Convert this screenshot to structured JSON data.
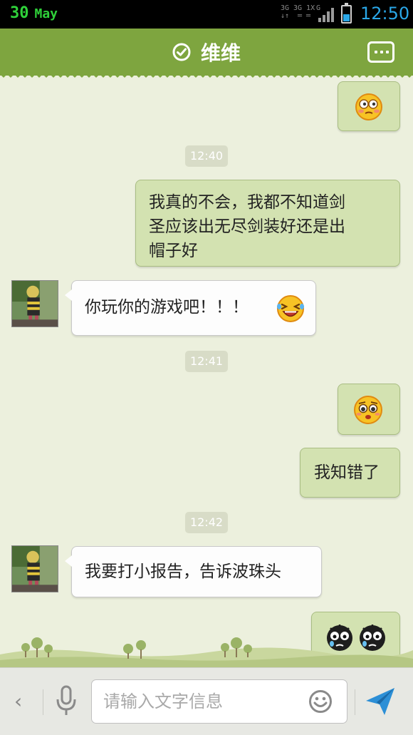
{
  "status_bar": {
    "day": "30",
    "month": "May",
    "net_top": "3G 3G 1X  G",
    "time": "12:50",
    "colors": {
      "clock": "#2aa7e8",
      "date": "#2fd13a"
    }
  },
  "header": {
    "title": "维维",
    "verified_icon": "check-circle-icon",
    "menu_icon": "more-dots-icon",
    "color": "#7ea53f"
  },
  "messages": [
    {
      "type": "emoji",
      "side": "sent",
      "emoji": "flushed-face-emoji"
    },
    {
      "type": "time",
      "text": "12:40"
    },
    {
      "type": "text",
      "side": "sent",
      "text": "我真的不会，我都不知道剑\n圣应该出无尽剑装好还是出\n帽子好"
    },
    {
      "type": "text",
      "side": "received",
      "text": "你玩你的游戏吧！！！",
      "emoji": "laughing-face-emoji"
    },
    {
      "type": "time",
      "text": "12:41"
    },
    {
      "type": "emoji",
      "side": "sent",
      "emoji": "pleading-face-emoji"
    },
    {
      "type": "text",
      "side": "sent",
      "text": "我知错了"
    },
    {
      "type": "time",
      "text": "12:42"
    },
    {
      "type": "text",
      "side": "received",
      "text": "我要打小报告，告诉波珠头"
    },
    {
      "type": "emoji",
      "side": "sent",
      "emoji": "crying-black-face-emoji",
      "count": 2
    }
  ],
  "input": {
    "placeholder": "请输入文字信息",
    "value": ""
  },
  "bottom_bar": {
    "back_icon": "chevron-left-icon",
    "mic_icon": "microphone-icon",
    "emoji_icon": "smiley-icon",
    "send_icon": "send-arrow-icon"
  }
}
